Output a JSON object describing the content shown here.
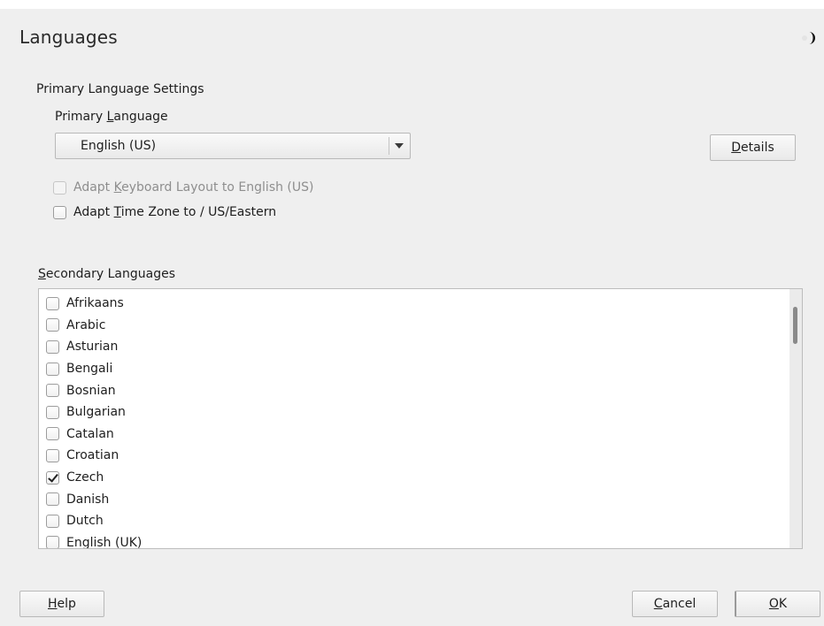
{
  "window": {
    "title": "Languages"
  },
  "primary": {
    "group_label": "Primary Language Settings",
    "field_label_pre": "Primary ",
    "field_label_mnemonic": "L",
    "field_label_post": "anguage",
    "selected_value": "English (US)",
    "details_mnemonic": "D",
    "details_rest": "etails",
    "adapt_keyboard_pre": "Adapt ",
    "adapt_keyboard_mnemonic": "K",
    "adapt_keyboard_post": "eyboard Layout to English (US)",
    "adapt_keyboard_checked": false,
    "adapt_keyboard_enabled": false,
    "adapt_timezone_pre": "Adapt ",
    "adapt_timezone_mnemonic": "T",
    "adapt_timezone_post": "ime Zone to  / US/Eastern",
    "adapt_timezone_checked": false
  },
  "secondary": {
    "label_mnemonic": "S",
    "label_rest": "econdary Languages",
    "items": [
      {
        "label": "Afrikaans",
        "checked": false
      },
      {
        "label": "Arabic",
        "checked": false
      },
      {
        "label": "Asturian",
        "checked": false
      },
      {
        "label": "Bengali",
        "checked": false
      },
      {
        "label": "Bosnian",
        "checked": false
      },
      {
        "label": "Bulgarian",
        "checked": false
      },
      {
        "label": "Catalan",
        "checked": false
      },
      {
        "label": "Croatian",
        "checked": false
      },
      {
        "label": "Czech",
        "checked": true
      },
      {
        "label": "Danish",
        "checked": false
      },
      {
        "label": "Dutch",
        "checked": false
      },
      {
        "label": "English (UK)",
        "checked": false
      }
    ]
  },
  "footer": {
    "help_mnemonic": "H",
    "help_rest": "elp",
    "cancel_mnemonic": "C",
    "cancel_rest": "ancel",
    "ok_mnemonic": "O",
    "ok_rest": "K"
  },
  "icons": {
    "logo": "distro-logo-icon",
    "dropdown": "chevron-down-icon",
    "check": "checkmark-icon"
  }
}
